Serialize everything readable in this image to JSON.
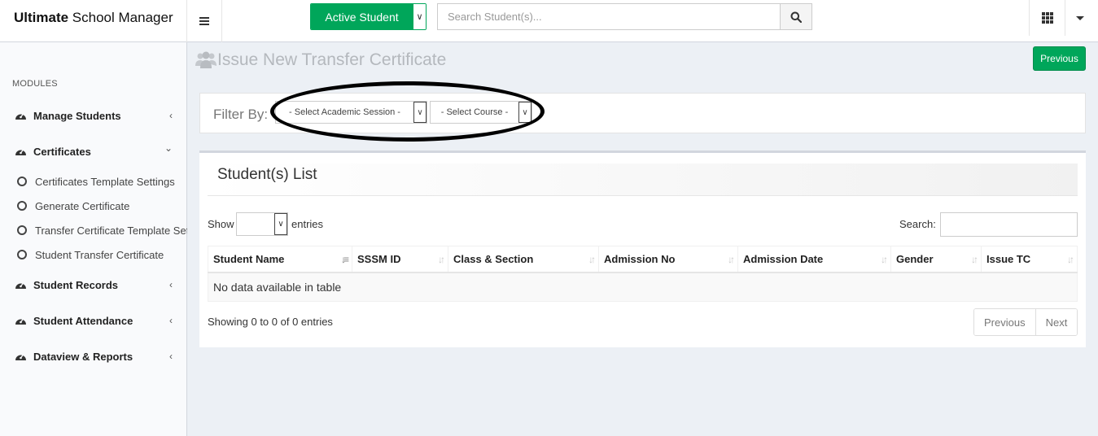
{
  "header": {
    "brand_bold": "Ultimate",
    "brand_rest": " School Manager",
    "menu_icon": "hamburger-icon",
    "active_student_label": "Active Student",
    "search_placeholder": "Search Student(s)...",
    "search_icon": "search-icon",
    "apps_icon": "grid-icon",
    "user_menu_icon": "caret-down-icon"
  },
  "sidebar": {
    "section_label": "MODULES",
    "items": [
      {
        "label": "Manage Students",
        "icon": "dashboard-icon",
        "chevron": "‹"
      },
      {
        "label": "Certificates",
        "icon": "dashboard-icon",
        "chevron": "⌄"
      },
      {
        "label": "Student Records",
        "icon": "dashboard-icon",
        "chevron": "‹"
      },
      {
        "label": "Student Attendance",
        "icon": "dashboard-icon",
        "chevron": "‹"
      },
      {
        "label": "Dataview & Reports",
        "icon": "dashboard-icon",
        "chevron": "‹"
      }
    ],
    "subitems": [
      {
        "label": "Certificates Template Settings"
      },
      {
        "label": "Generate Certificate"
      },
      {
        "label": "Transfer Certificate Template Settings"
      },
      {
        "label": "Student Transfer Certificate"
      }
    ]
  },
  "page": {
    "title": "Issue New Transfer Certificate",
    "title_icon": "users-icon",
    "previous_button": "Previous"
  },
  "filter": {
    "label": "Filter By:",
    "session_select": "- Select Academic Session -",
    "course_select": "- Select Course -"
  },
  "list": {
    "title": "Student(s) List",
    "show_label": "Show",
    "show_value": "",
    "entries_label": "entries",
    "search_label": "Search:",
    "columns": [
      "Student Name",
      "SSSM ID",
      "Class & Section",
      "Admission No",
      "Admission Date",
      "Gender",
      "Issue TC"
    ],
    "empty_message": "No data available in table",
    "info": "Showing 0 to 0 of 0 entries",
    "pager_previous": "Previous",
    "pager_next": "Next"
  },
  "colors": {
    "accent_green": "#00a65a",
    "background": "#ecf0f5",
    "sidebar_bg": "#f9fafc"
  }
}
